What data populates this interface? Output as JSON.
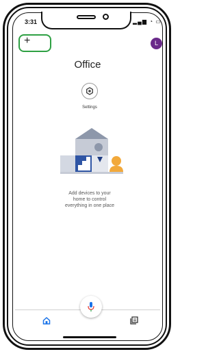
{
  "status_bar": {
    "time": "3:31",
    "icons": "▂▄▆ ◔ ▭"
  },
  "header": {
    "add_label": "+",
    "avatar_initial": "L"
  },
  "home": {
    "title": "Office"
  },
  "settings": {
    "label": "Settings"
  },
  "empty_state": {
    "line1": "Add devices to your",
    "line2": "home to control",
    "line3": "everything in one place"
  },
  "nav": {
    "items": [
      {
        "name": "home",
        "icon": "home-icon"
      },
      {
        "name": "feed",
        "icon": "feed-icon"
      }
    ]
  },
  "colors": {
    "accent": "#1a73e8",
    "avatar": "#6a2a8a",
    "highlight": "#2ea043"
  }
}
